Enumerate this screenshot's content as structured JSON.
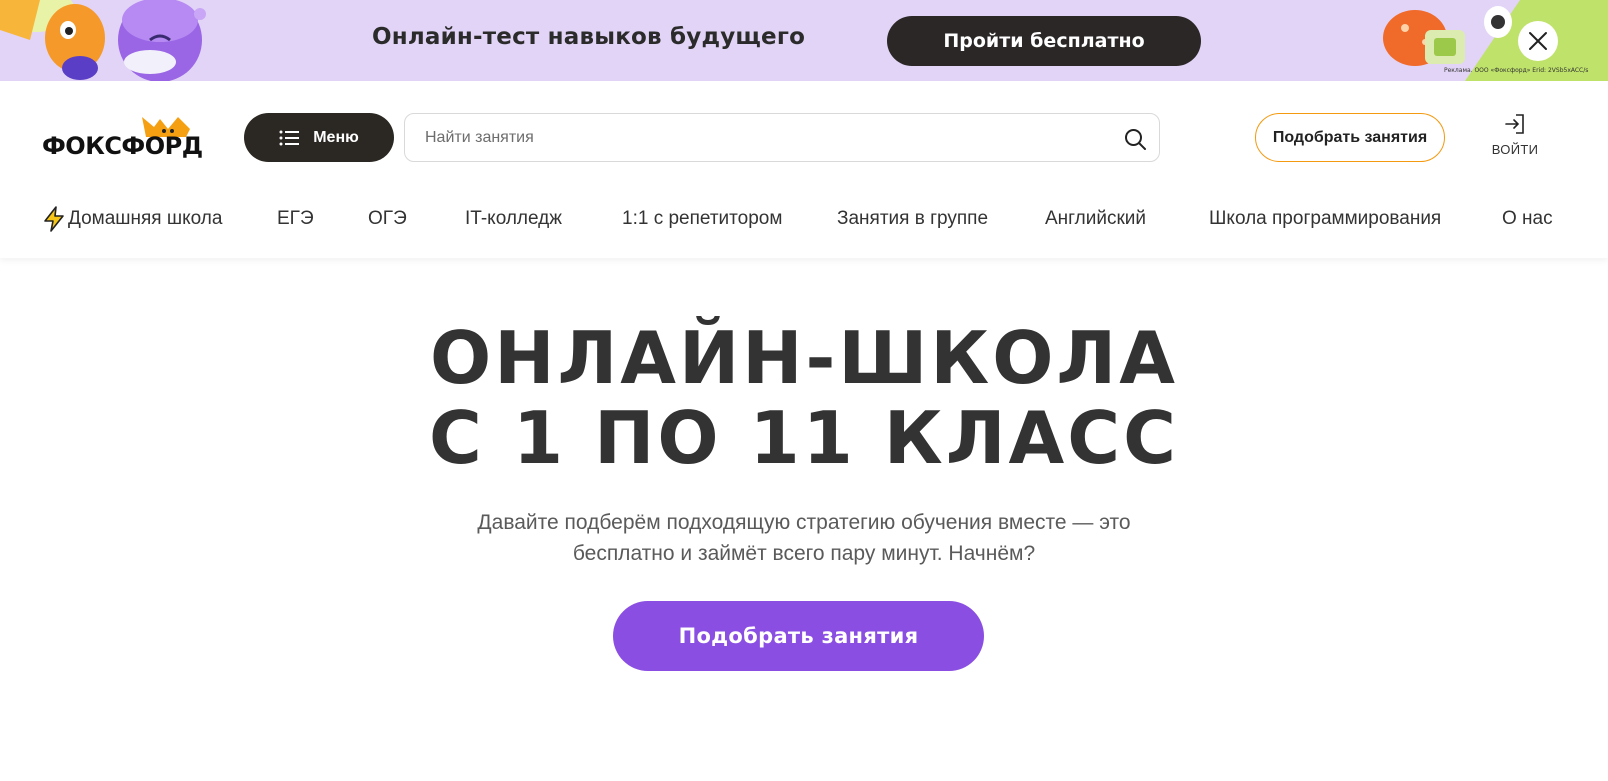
{
  "promo": {
    "text": "Онлайн-тест навыков будущего",
    "button_label": "Пройти бесплатно",
    "ad_note": "Реклама. ООО «Фоксфорд» Erid: 2VSb5xACC/s",
    "close_icon": "close-icon"
  },
  "header": {
    "logo_text": "ФОКСФОРД",
    "menu_label": "Меню",
    "search_placeholder": "Найти занятия",
    "pick_label": "Подобрать занятия",
    "login_label": "ВОЙТИ"
  },
  "nav": {
    "items": [
      {
        "label": "Домашняя школа",
        "icon": "lightning-icon"
      },
      {
        "label": "ЕГЭ"
      },
      {
        "label": "ОГЭ"
      },
      {
        "label": "IT-колледж"
      },
      {
        "label": "1:1 с репетитором"
      },
      {
        "label": "Занятия в группе"
      },
      {
        "label": "Английский"
      },
      {
        "label": "Школа программирования"
      },
      {
        "label": "О нас"
      }
    ]
  },
  "hero": {
    "title_line1": "ОНЛАЙН-ШКОЛА",
    "title_line2": "С 1 ПО 11 КЛАСС",
    "subtitle_line1": "Давайте подберём подходящую стратегию обучения вместе — это",
    "subtitle_line2": "бесплатно и займёт всего пару минут. Начнём?",
    "cta_label": "Подобрать занятия"
  },
  "colors": {
    "promo_bg": "#e2d4f6",
    "dark_button": "#2b2722",
    "accent_orange": "#f39a10",
    "cta_purple": "#8a4ee2",
    "text": "#333333"
  }
}
